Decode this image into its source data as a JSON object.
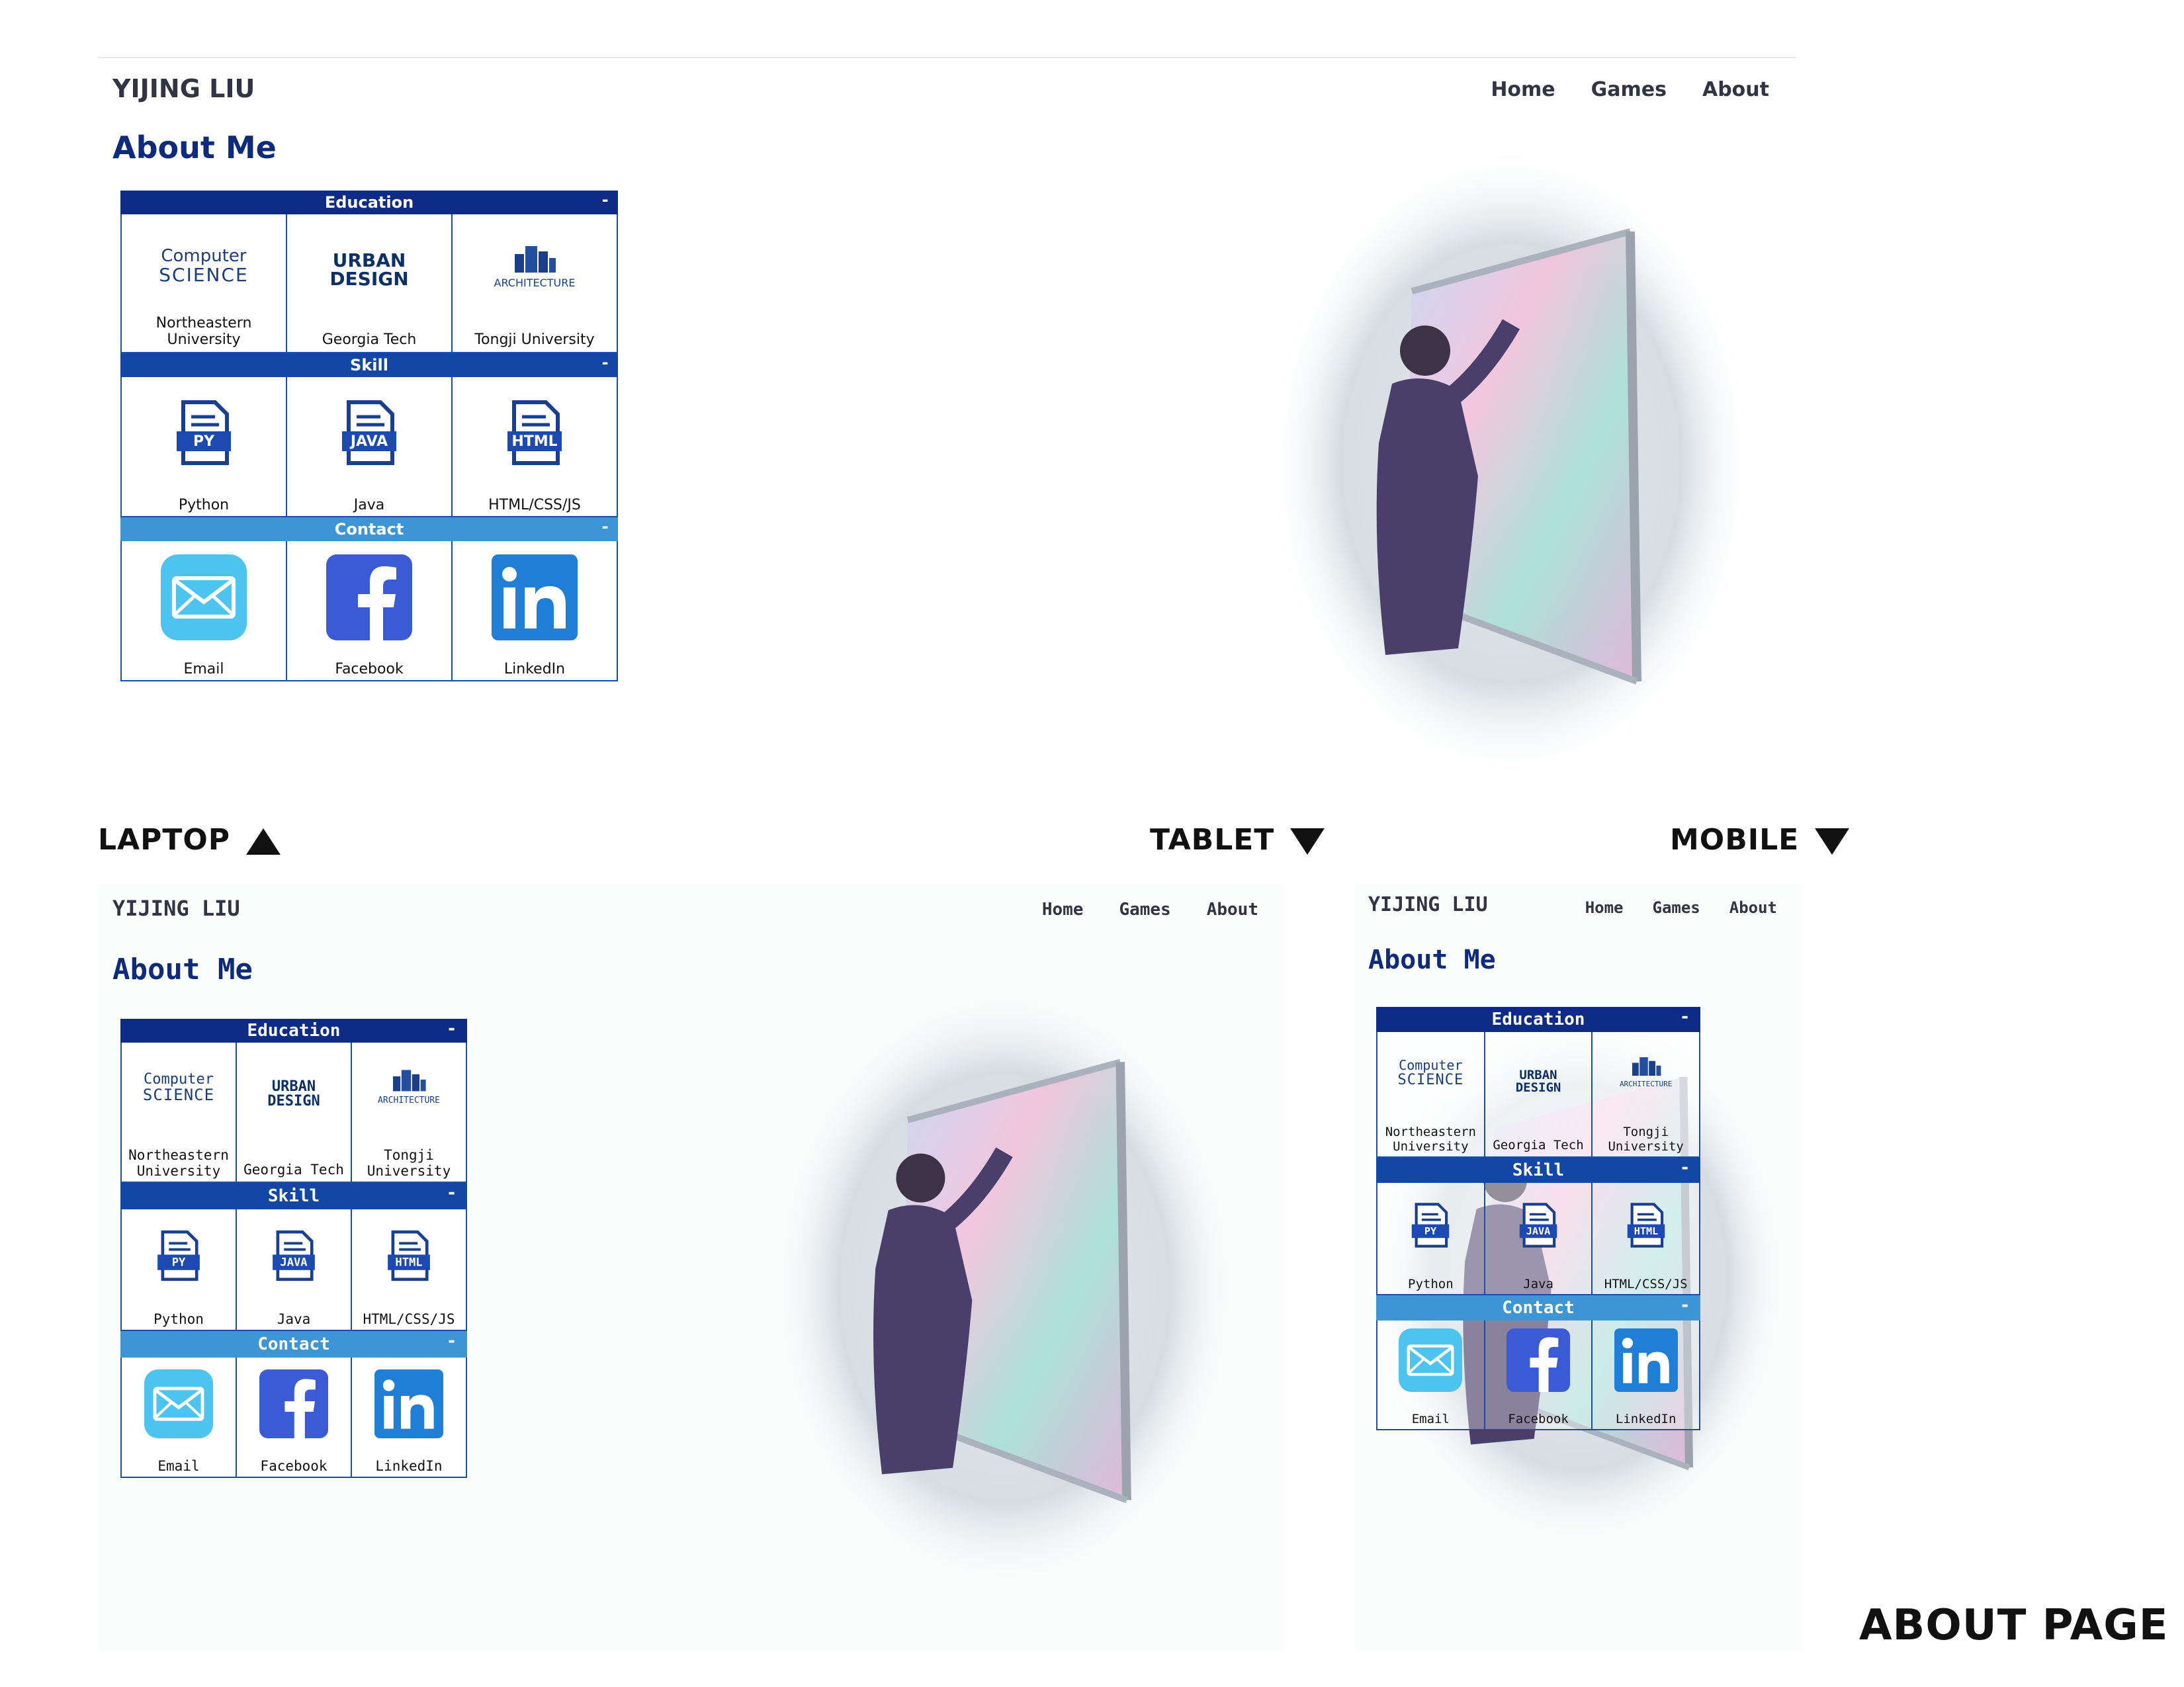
{
  "site": {
    "brand": "YIJING LIU",
    "nav": [
      "Home",
      "Games",
      "About"
    ],
    "page_title": "About Me"
  },
  "sections": {
    "education": {
      "title": "Education",
      "collapse": "-",
      "items": [
        {
          "logo_line1": "Computer",
          "logo_line2": "SCIENCE",
          "label": "Northeastern University"
        },
        {
          "logo_line1": "URBAN",
          "logo_line2": "DESIGN",
          "label": "Georgia Tech"
        },
        {
          "logo_line1": "ARCHITECTURE",
          "logo_line2": "",
          "label": "Tongji University"
        }
      ]
    },
    "skill": {
      "title": "Skill",
      "collapse": "-",
      "items": [
        {
          "badge": "PY",
          "label": "Python"
        },
        {
          "badge": "JAVA",
          "label": "Java"
        },
        {
          "badge": "HTML",
          "label": "HTML/CSS/JS"
        }
      ]
    },
    "contact": {
      "title": "Contact",
      "collapse": "-",
      "items": [
        {
          "icon": "email-icon",
          "label": "Email"
        },
        {
          "icon": "facebook-icon",
          "label": "Facebook"
        },
        {
          "icon": "linkedin-icon",
          "label": "LinkedIn"
        }
      ]
    }
  },
  "device_labels": {
    "laptop": "LAPTOP",
    "tablet": "TABLET",
    "mobile": "MOBILE"
  },
  "page_label": "ABOUT PAGE",
  "colors": {
    "navy": "#0e2c86",
    "blue": "#1247a6",
    "sky": "#3d95d6",
    "title": "#0d2b7a"
  }
}
